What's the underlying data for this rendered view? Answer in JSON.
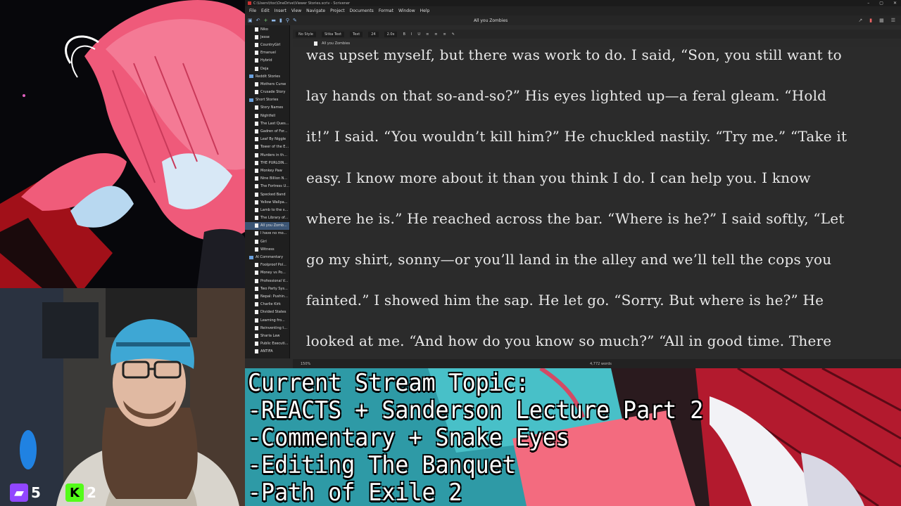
{
  "window": {
    "path": "C:\\Users\\ttoc\\OneDrive\\Viewer Stories.scriv - Scrivener",
    "controls": [
      "–",
      "▢",
      "✕"
    ]
  },
  "menu": [
    "File",
    "Edit",
    "Insert",
    "View",
    "Navigate",
    "Project",
    "Documents",
    "Format",
    "Window",
    "Help"
  ],
  "toolbar": {
    "document_title": "All you Zombies"
  },
  "format_bar": {
    "style": "No Style",
    "font": "Sitka Text",
    "weight": "Text",
    "size": "24",
    "spacing": "2.0x"
  },
  "header_bar": {
    "document": "All you Zombies"
  },
  "binder": [
    {
      "label": "Niko",
      "type": "doc"
    },
    {
      "label": "Jesse",
      "type": "doc"
    },
    {
      "label": "CountryGirl",
      "type": "doc"
    },
    {
      "label": "Emanuel",
      "type": "doc"
    },
    {
      "label": "Hybrid",
      "type": "doc"
    },
    {
      "label": "Deja",
      "type": "doc"
    },
    {
      "label": "Reddit Stories",
      "type": "folder"
    },
    {
      "label": "Mothers Curse",
      "type": "doc"
    },
    {
      "label": "Crusade Story",
      "type": "doc"
    },
    {
      "label": "Short Stories",
      "type": "folder"
    },
    {
      "label": "Story Names",
      "type": "doc"
    },
    {
      "label": "Nightfell",
      "type": "doc"
    },
    {
      "label": "The Last Ques...",
      "type": "doc"
    },
    {
      "label": "Gadren of For...",
      "type": "doc"
    },
    {
      "label": "Leaf By Niggle",
      "type": "doc"
    },
    {
      "label": "Tower of the E...",
      "type": "doc"
    },
    {
      "label": "Murders in th...",
      "type": "doc"
    },
    {
      "label": "THE PURLOIN...",
      "type": "doc"
    },
    {
      "label": "Monkey Paw",
      "type": "doc"
    },
    {
      "label": "Nine Billion N...",
      "type": "doc"
    },
    {
      "label": "The Fortress U...",
      "type": "doc"
    },
    {
      "label": "Specked Band",
      "type": "doc"
    },
    {
      "label": "Yellow Wallpa...",
      "type": "doc"
    },
    {
      "label": "Lamb to the s...",
      "type": "doc"
    },
    {
      "label": "The Library of...",
      "type": "doc"
    },
    {
      "label": "All you Zomb...",
      "type": "doc",
      "selected": true
    },
    {
      "label": "I have no mo...",
      "type": "doc"
    },
    {
      "label": "Girl",
      "type": "doc"
    },
    {
      "label": "Witness",
      "type": "doc"
    },
    {
      "label": "AI Commentary",
      "type": "folder"
    },
    {
      "label": "Foolproof Pol...",
      "type": "doc"
    },
    {
      "label": "Money vs Po...",
      "type": "doc"
    },
    {
      "label": "Professional V...",
      "type": "doc"
    },
    {
      "label": "Two Party Sys...",
      "type": "doc"
    },
    {
      "label": "Nepal: Pushin...",
      "type": "doc"
    },
    {
      "label": "Charlie Kirk",
      "type": "doc"
    },
    {
      "label": "Divided States",
      "type": "doc"
    },
    {
      "label": "Learning fro...",
      "type": "doc"
    },
    {
      "label": "Reinventing t...",
      "type": "doc"
    },
    {
      "label": "Sharia Law",
      "type": "doc"
    },
    {
      "label": "Public Executi...",
      "type": "doc"
    },
    {
      "label": "ANTIFA",
      "type": "doc"
    }
  ],
  "editor_lines": [
    "was upset myself, but there was work to do. I said, “Son, you still want to",
    "lay hands on that so-and-so?” His eyes lighted up—a feral gleam. “Hold",
    "it!” I said. “You wouldn’t kill him?” He chuckled nastily. “Try me.” “Take it",
    "easy. I know more about it than you think I do. I can help you. I know",
    "where he is.” He reached across the bar. “Where is he?” I said softly, “Let",
    "go my shirt, sonny—or you’ll land in the alley and we’ll tell the cops you",
    "fainted.” I showed him the sap. He let go. “Sorry. But where is he?” He",
    "looked at me. “And how do you know so much?” “All in good time. There"
  ],
  "status_bar": {
    "zoom": "150%",
    "word_count": "4,772 words"
  },
  "banner": {
    "lines": [
      "Current Stream Topic:",
      "-REACTS + Sanderson Lecture Part 2",
      "-Commentary + Snake Eyes",
      "-Editing The Banquet",
      "-Path of Exile 2"
    ]
  },
  "badges": {
    "twitch_count": "5",
    "kick_count": "2"
  },
  "colors": {
    "accent": "#6aa0dd",
    "selection": "#3b5575",
    "twitch": "#9146ff",
    "kick": "#53fc18"
  }
}
